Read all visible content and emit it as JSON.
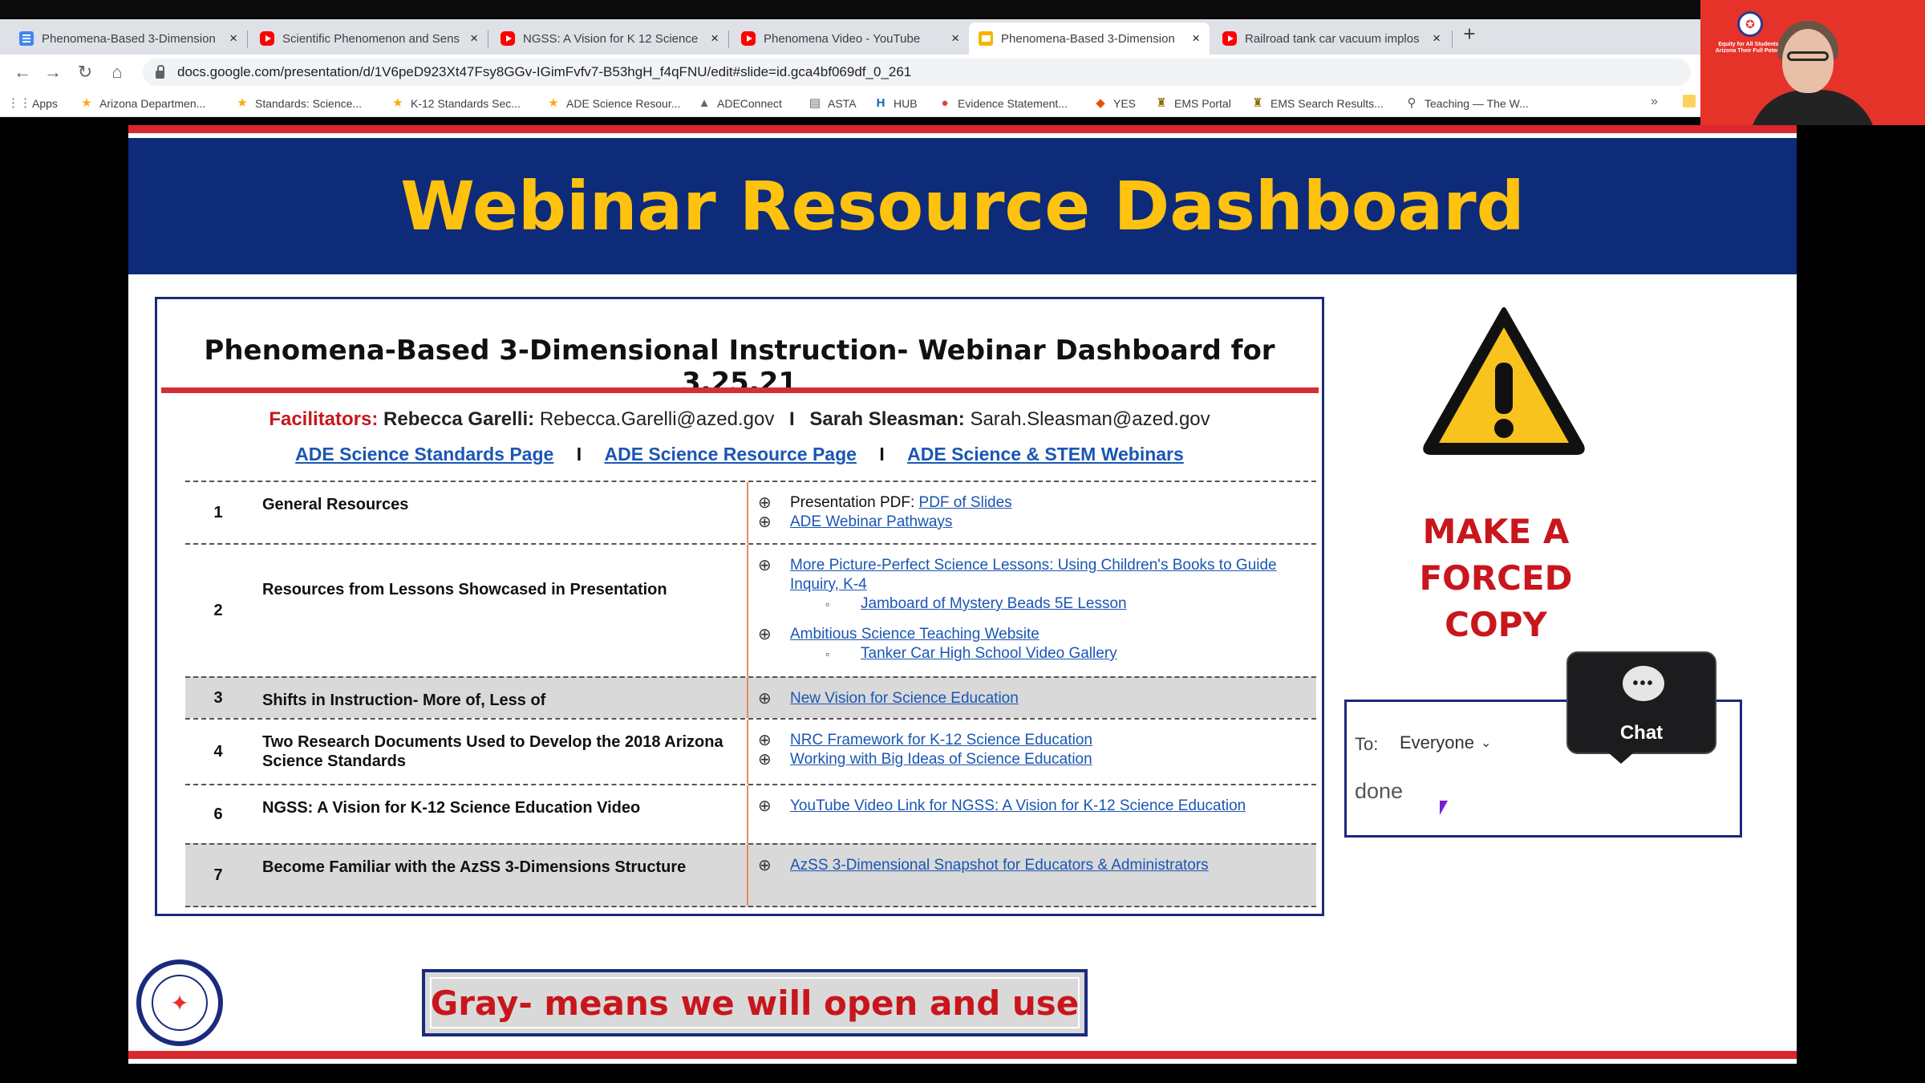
{
  "browser": {
    "tabs": [
      {
        "title": "Phenomena-Based 3-Dimension",
        "icon": "docs-icon"
      },
      {
        "title": "Scientific Phenomenon and Sens",
        "icon": "youtube-icon"
      },
      {
        "title": "NGSS: A Vision for K 12 Science",
        "icon": "youtube-icon"
      },
      {
        "title": "Phenomena Video - YouTube",
        "icon": "youtube-icon"
      },
      {
        "title": "Phenomena-Based 3-Dimension",
        "icon": "slides-icon",
        "active": true
      },
      {
        "title": "Railroad tank car vacuum implos",
        "icon": "youtube-icon"
      }
    ],
    "tab_close": "×",
    "new_tab": "+",
    "url": "docs.google.com/presentation/d/1V6peD923Xt47Fsy8GGv-IGimFvfv7-B53hgH_f4qFNU/edit#slide=id.gca4bf069df_0_261",
    "bookmarks": [
      {
        "label": "Apps",
        "icon": "apps-grid-icon"
      },
      {
        "label": "Arizona Departmen...",
        "icon": "star-icon"
      },
      {
        "label": "Standards: Science...",
        "icon": "star-icon"
      },
      {
        "label": "K-12 Standards Sec...",
        "icon": "star-icon"
      },
      {
        "label": "ADE Science Resour...",
        "icon": "star-icon"
      },
      {
        "label": "ADEConnect",
        "icon": "adeconnect-icon"
      },
      {
        "label": "ASTA",
        "icon": "page-icon"
      },
      {
        "label": "HUB",
        "icon": "hub-icon"
      },
      {
        "label": "Evidence Statement...",
        "icon": "chrome-icon"
      },
      {
        "label": "YES",
        "icon": "yes-icon"
      },
      {
        "label": "EMS Portal",
        "icon": "ems-icon"
      },
      {
        "label": "EMS Search Results...",
        "icon": "ems-icon"
      },
      {
        "label": "Teaching — The W...",
        "icon": "pin-icon"
      }
    ],
    "bookmarks_more": "»",
    "colors": {
      "tabstrip": "#dee1e6",
      "active_tab": "#ffffff"
    }
  },
  "webcam": {
    "tagline": "Equity for All Students in Arizona Their Full Potential"
  },
  "slide": {
    "title": "Webinar Resource Dashboard",
    "dashboard": {
      "title": "Phenomena-Based 3-Dimensional Instruction- Webinar Dashboard for 3.25.21",
      "facilitators_label": "Facilitators:",
      "facilitator_1_name": "Rebecca Garelli:",
      "facilitator_1_email": "Rebecca.Garelli@azed.gov",
      "facilitator_2_name": "Sarah Sleasman:",
      "facilitator_2_email": "Sarah.Sleasman@azed.gov",
      "separator": "I",
      "links": [
        "ADE Science Standards Page",
        "ADE Science Resource Page",
        "ADE Science & STEM Webinars"
      ],
      "rows": [
        {
          "num": "1",
          "title": "General Resources",
          "gray": false,
          "items": [
            {
              "prefix": "Presentation PDF: ",
              "link": "PDF of Slides"
            },
            {
              "link": "ADE Webinar Pathways"
            }
          ]
        },
        {
          "num": "2",
          "title": "Resources from Lessons Showcased in Presentation",
          "gray": false,
          "items": [
            {
              "link": "More Picture-Perfect Science Lessons: Using Children's Books to Guide Inquiry, K-4"
            },
            {
              "link": "Jamboard of Mystery Beads 5E Lesson",
              "sub": true
            },
            {
              "gap": true
            },
            {
              "link": "Ambitious Science Teaching Website"
            },
            {
              "link": "Tanker Car High School Video Gallery",
              "sub": true
            }
          ]
        },
        {
          "num": "3",
          "title": "Shifts in Instruction- More of, Less of",
          "gray": true,
          "items": [
            {
              "link": "New Vision for Science Education"
            }
          ]
        },
        {
          "num": "4",
          "title": "Two Research Documents Used to Develop the 2018 Arizona Science Standards",
          "gray": false,
          "items": [
            {
              "link": "NRC Framework for K-12 Science Education"
            },
            {
              "link": "Working with Big Ideas of Science Education"
            }
          ]
        },
        {
          "num": "6",
          "title": "NGSS: A Vision for K-12 Science Education Video",
          "gray": false,
          "items": [
            {
              "link": "YouTube Video Link for NGSS: A Vision for K-12 Science Education"
            }
          ]
        },
        {
          "num": "7",
          "title": "Become Familiar with the AzSS 3-Dimensions Structure",
          "gray": true,
          "items": [
            {
              "link": "AzSS 3-Dimensional Snapshot for Educators & Administrators"
            }
          ]
        }
      ],
      "bullet_main": "⊕",
      "bullet_sub": "▫"
    },
    "warning_text": "MAKE A FORCED COPY",
    "chat": {
      "to_label": "To:",
      "to_value": "Everyone",
      "input_value": "done",
      "bubble_label": "Chat"
    },
    "gray_note": "Gray- means we will open and use",
    "colors": {
      "header_bg": "#0e2b7a",
      "title": "#ffc20e",
      "accent_red": "#d9272e",
      "link": "#1a56b4",
      "gray_row": "#d9d9d9"
    }
  }
}
